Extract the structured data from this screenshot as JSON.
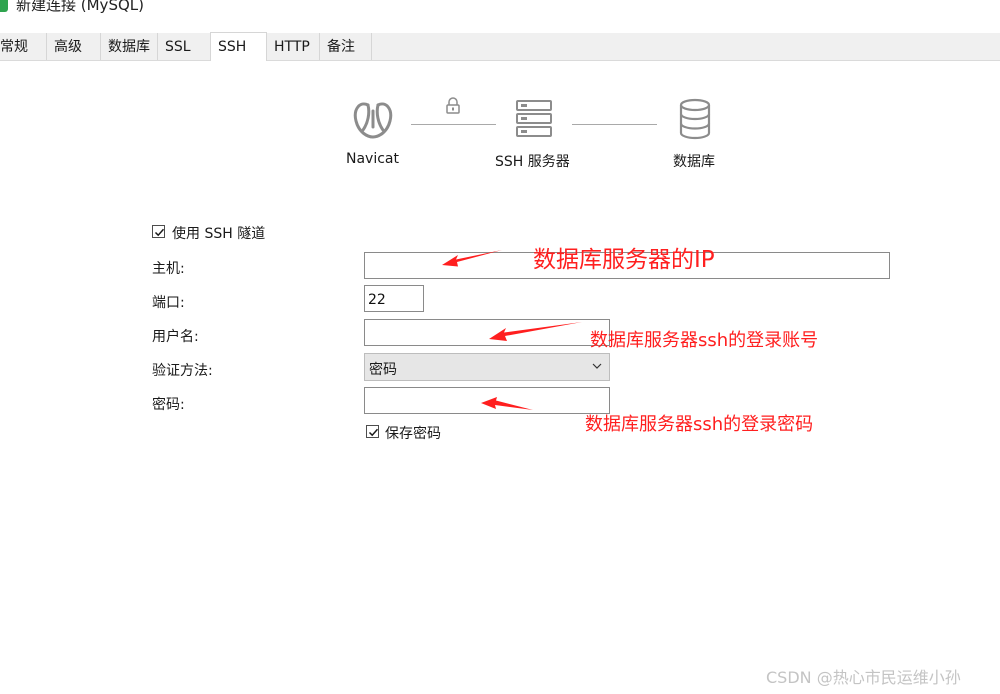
{
  "window": {
    "title": "新建连接 (MySQL)"
  },
  "tabs": [
    {
      "label": "常规"
    },
    {
      "label": "高级"
    },
    {
      "label": "数据库"
    },
    {
      "label": "SSL"
    },
    {
      "label": "SSH",
      "active": true
    },
    {
      "label": "HTTP"
    },
    {
      "label": "备注"
    }
  ],
  "diagram": {
    "client_label": "Navicat",
    "server_label": "SSH 服务器",
    "db_label": "数据库"
  },
  "form": {
    "use_tunnel_label": "使用 SSH 隧道",
    "use_tunnel_checked": true,
    "host_label": "主机:",
    "host_value": "",
    "port_label": "端口:",
    "port_value": "22",
    "user_label": "用户名:",
    "user_value": "",
    "auth_label": "验证方法:",
    "auth_value": "密码",
    "password_label": "密码:",
    "password_value": "",
    "save_password_label": "保存密码",
    "save_password_checked": true
  },
  "annotations": {
    "host_note": "数据库服务器的IP",
    "user_note": "数据库服务器ssh的登录账号",
    "password_note": "数据库服务器ssh的登录密码",
    "color": "#ff1f1f"
  },
  "watermark": "CSDN @热心市民运维小孙"
}
